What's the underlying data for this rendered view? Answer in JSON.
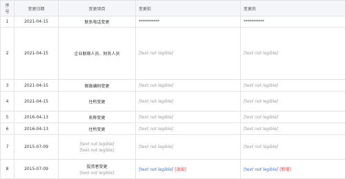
{
  "placeholder_text": "[text not legible]",
  "headers": {
    "num": "序号",
    "date": "变更日期",
    "item": "变更项目",
    "before": "变更前",
    "after": "变更后"
  },
  "rows": [
    {
      "num": "1",
      "date": "2021-04-15",
      "item": "联系电话变更",
      "item_sub": "",
      "before": "**********",
      "after": "**********",
      "before_marker": "",
      "after_marker": ""
    },
    {
      "num": "2",
      "date": "2021-04-15",
      "item": "企业联络人员、财务人员",
      "item_sub": "",
      "before": "[text not legible]",
      "after": "[text not legible]",
      "before_marker": "",
      "after_marker": ""
    },
    {
      "num": "3",
      "date": "2021-04-15",
      "item": "邮政编码变更",
      "item_sub": "",
      "before": "[text not legible]",
      "after": "[text not legible]",
      "before_marker": "",
      "after_marker": ""
    },
    {
      "num": "4",
      "date": "2021-04-15",
      "item": "住所变更",
      "item_sub": "",
      "before": "[text not legible]",
      "after": "[text not legible]",
      "before_marker": "",
      "after_marker": ""
    },
    {
      "num": "5",
      "date": "2016-04-13",
      "item": "名称变更",
      "item_sub": "",
      "before": "[text not legible]",
      "after": "[text not legible]",
      "before_marker": "",
      "after_marker": ""
    },
    {
      "num": "6",
      "date": "2016-04-13",
      "item": "住所变更",
      "item_sub": "",
      "before": "[text not legible]",
      "after": "[text not legible]",
      "before_marker": "",
      "after_marker": ""
    },
    {
      "num": "7",
      "date": "2015-07-09",
      "item": "[text not legible]",
      "item_sub": "[text not legible]",
      "before": "[text not legible]",
      "after": "[text not legible]",
      "before_marker": "",
      "after_marker": ""
    },
    {
      "num": "8",
      "date": "2015-07-09",
      "item": "投资者变更",
      "item_sub": "[text not legible]",
      "before": "[text not legible]",
      "after": "[text not legible]",
      "before_marker": "[退出]",
      "after_marker": "[新增]"
    }
  ]
}
